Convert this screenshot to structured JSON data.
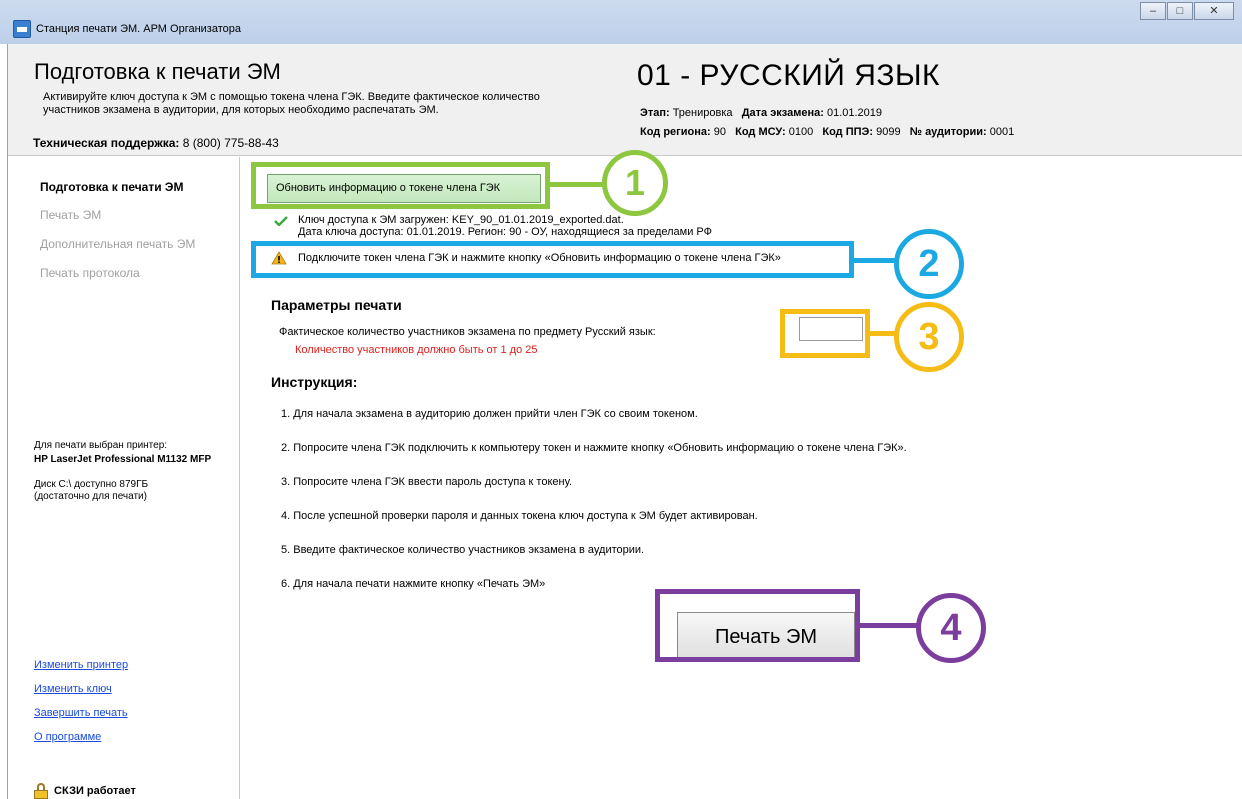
{
  "window": {
    "title": "Станция печати ЭМ. АРМ Организатора",
    "buttons": [
      "minimize",
      "maximize",
      "close"
    ]
  },
  "header": {
    "title": "Подготовка к печати ЭМ",
    "subtitle_line1": "Активируйте ключ доступа к ЭМ с помощью токена члена ГЭК. Введите фактическое количество",
    "subtitle_line2": "участников экзамена в аудитории, для которых необходимо распечатать ЭМ.",
    "support_label": "Техническая поддержка:",
    "support_phone": "8 (800) 775-88-43",
    "subject": "01 - РУССКИЙ ЯЗЫК",
    "stage_label": "Этап:",
    "stage_value": "Тренировка",
    "exam_date_label": "Дата экзамена:",
    "exam_date_value": "01.01.2019",
    "region_label": "Код региона:",
    "region_value": "90",
    "msu_label": "Код МСУ:",
    "msu_value": "0100",
    "ppe_label": "Код ППЭ:",
    "ppe_value": "9099",
    "room_label": "№ аудитории:",
    "room_value": "0001"
  },
  "sidebar": {
    "items": [
      {
        "label": "Подготовка к печати ЭМ",
        "active": true
      },
      {
        "label": "Печать ЭМ",
        "active": false
      },
      {
        "label": "Дополнительная печать ЭМ",
        "active": false
      },
      {
        "label": "Печать протокола",
        "active": false
      }
    ],
    "printer_label": "Для печати выбран принтер:",
    "printer_name": "HP LaserJet Professional M1132 MFP",
    "disk_line1": "Диск C:\\ доступно 879ГБ",
    "disk_line2": "(достаточно для печати)",
    "links": [
      "Изменить принтер",
      "Изменить ключ",
      "Завершить печать",
      "О программе"
    ],
    "skzi_status": "СКЗИ работает"
  },
  "main": {
    "update_button": "Обновить информацию о токене члена ГЭК",
    "key_status_line1": "Ключ доступа к ЭМ загружен: KEY_90_01.01.2019_exported.dat.",
    "key_status_line2": "Дата ключа доступа: 01.01.2019. Регион: 90 - ОУ, находящиеся за пределами РФ",
    "warning": "Подключите токен члена ГЭК и нажмите кнопку «Обновить информацию о токене члена ГЭК»",
    "params_title": "Параметры печати",
    "params_label": "Фактическое количество участников экзамена по предмету Русский язык:",
    "params_error": "Количество участников должно быть от 1 до 25",
    "count_value": "",
    "instructions_title": "Инструкция:",
    "instructions": [
      "1. Для начала экзамена в аудиторию должен прийти член ГЭК со своим токеном.",
      "2. Попросите члена ГЭК подключить к компьютеру токен и нажмите кнопку «Обновить информацию о токене члена ГЭК».",
      "3. Попросите члена ГЭК ввести пароль доступа к токену.",
      "4. После успешной проверки пароля и данных токена ключ доступа к ЭМ будет активирован.",
      "5. Введите фактическое количество участников экзамена в аудитории.",
      "6. Для начала печати нажмите кнопку «Печать ЭМ»"
    ],
    "print_button": "Печать ЭМ"
  },
  "callouts": [
    {
      "number": "1",
      "color": "#8dc63f"
    },
    {
      "number": "2",
      "color": "#1ca9e3"
    },
    {
      "number": "3",
      "color": "#f6bc16"
    },
    {
      "number": "4",
      "color": "#7b3d9e"
    }
  ]
}
